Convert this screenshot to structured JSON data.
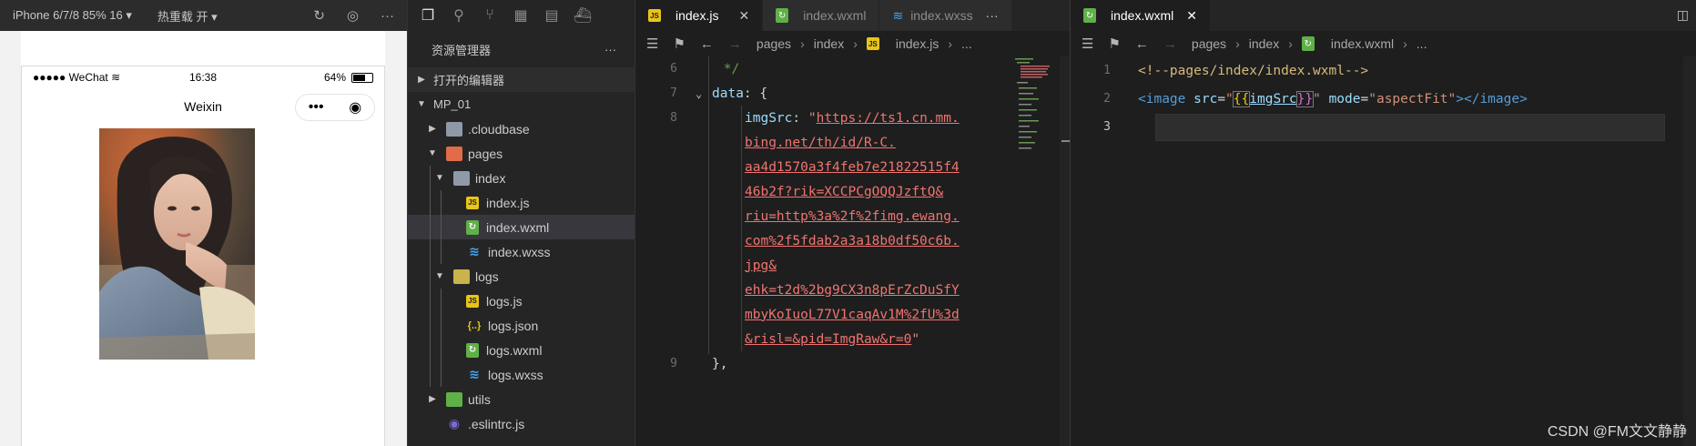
{
  "simulator": {
    "device": "iPhone 6/7/8 85% 16 ▾",
    "hot_reload": "热重载 开 ▾",
    "status_left": "●●●●● WeChat",
    "status_time": "16:38",
    "status_battery": "64%",
    "battery_level": 0.64,
    "nav_title": "Weixin",
    "capsule_more": "•••",
    "capsule_close": "◉"
  },
  "explorer": {
    "title": "资源管理器",
    "more": "···",
    "open_editors": "打开的编辑器",
    "project": "MP_01",
    "items": [
      {
        "label": ".cloudbase"
      },
      {
        "label": "pages"
      },
      {
        "label": "index"
      },
      {
        "label": "index.js"
      },
      {
        "label": "index.wxml"
      },
      {
        "label": "index.wxss"
      },
      {
        "label": "logs"
      },
      {
        "label": "logs.js"
      },
      {
        "label": "logs.json"
      },
      {
        "label": "logs.wxml"
      },
      {
        "label": "logs.wxss"
      },
      {
        "label": "utils"
      },
      {
        "label": ".eslintrc.js"
      }
    ],
    "icon_js": "JS",
    "icon_json": "{..}"
  },
  "editor1": {
    "tabs": [
      {
        "label": "index.js"
      },
      {
        "label": "index.wxml"
      },
      {
        "label": "index.wxss"
      }
    ],
    "tabs_more": "···",
    "crumbs": [
      "pages",
      "index",
      "index.js",
      "..."
    ],
    "lines": {
      "n6": "6",
      "n7": "7",
      "n8": "8",
      "n9": "9",
      "l6": " */",
      "l7_key": "data",
      "l7_rest": ": {",
      "l8_key": "imgSrc",
      "l8_colon": ": ",
      "quote": "\"",
      "url_parts": [
        "https://ts1.cn.mm.",
        "bing.net/th/id/R-C.",
        "aa4d1570a3f4feb7e21822515f4",
        "46b2f?rik=XCCPCgOQQJzftQ&",
        "riu=http%3a%2f%2fimg.ewang.",
        "com%2f5fdab2a3a18b0df50c6b.",
        "jpg&",
        "ehk=t2d%2bg9CX3n8pErZcDuSfY",
        "mbyKoIuoL77V1caqAv1M%2fU%3d",
        "&risl=&pid=ImgRaw&r=0"
      ],
      "l9": "},"
    }
  },
  "editor2": {
    "tab": "index.wxml",
    "tab_close": "✕",
    "crumbs": [
      "pages",
      "index",
      "index.wxml",
      "..."
    ],
    "n1": "1",
    "n2": "2",
    "n3": "3",
    "l1": "<!--pages/index/index.wxml-->",
    "l2_open": "<image",
    "l2_src_attr": " src",
    "l2_eq": "=",
    "l2_q": "\"",
    "l2_mus_open": "{{",
    "l2_var": "imgSrc",
    "l2_mus_close": "}}",
    "l2_mode_attr": " mode",
    "l2_mode_val": "\"aspectFit\"",
    "l2_close": "></image>",
    "watermark": "CSDN @FM文文静静"
  }
}
